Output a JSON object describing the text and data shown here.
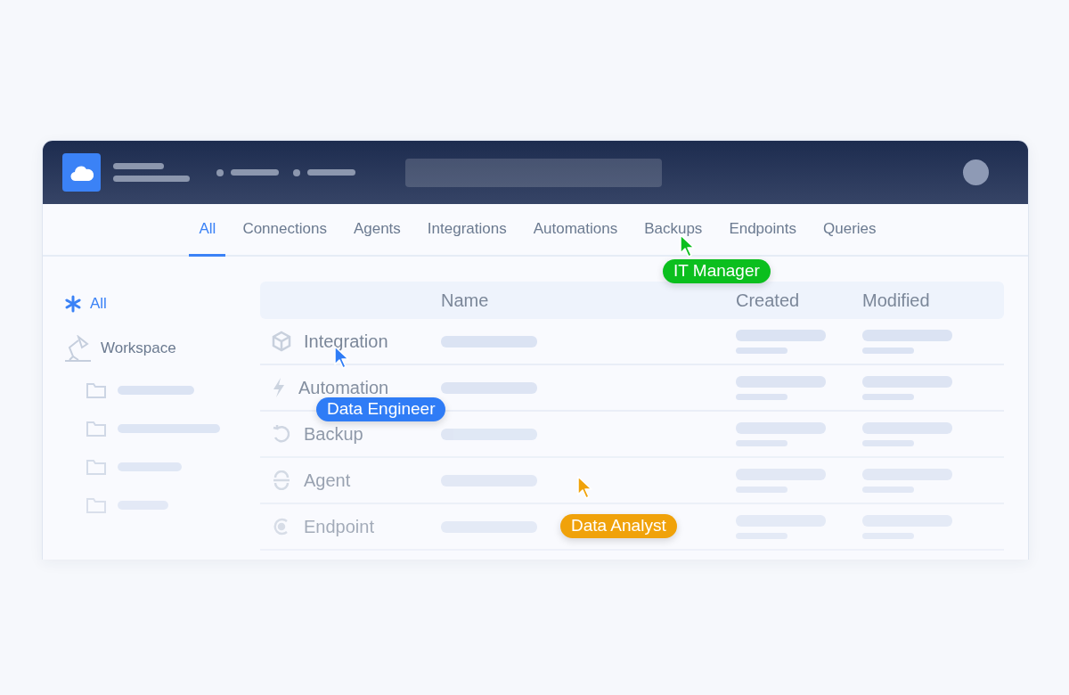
{
  "tabs": [
    {
      "label": "All",
      "selected": true
    },
    {
      "label": "Connections",
      "selected": false
    },
    {
      "label": "Agents",
      "selected": false
    },
    {
      "label": "Integrations",
      "selected": false
    },
    {
      "label": "Automations",
      "selected": false
    },
    {
      "label": "Backups",
      "selected": false
    },
    {
      "label": "Endpoints",
      "selected": false
    },
    {
      "label": "Queries",
      "selected": false
    }
  ],
  "sidebar": {
    "items": [
      {
        "label": "All",
        "kind": "all",
        "selected": true
      },
      {
        "label": "Workspace",
        "kind": "workspace",
        "selected": false
      }
    ]
  },
  "table": {
    "columns": [
      "Name",
      "Created",
      "Modified"
    ],
    "rows": [
      {
        "type": "Integration",
        "kind": "integration"
      },
      {
        "type": "Automation",
        "kind": "automation"
      },
      {
        "type": "Backup",
        "kind": "backup"
      },
      {
        "type": "Agent",
        "kind": "agent"
      },
      {
        "type": "Endpoint",
        "kind": "endpoint"
      }
    ]
  },
  "cursors": [
    {
      "label": "IT Manager",
      "color": "#0bbf1e"
    },
    {
      "label": "Data Engineer",
      "color": "#2f7cf6"
    },
    {
      "label": "Data Analyst",
      "color": "#f0a20a"
    }
  ]
}
